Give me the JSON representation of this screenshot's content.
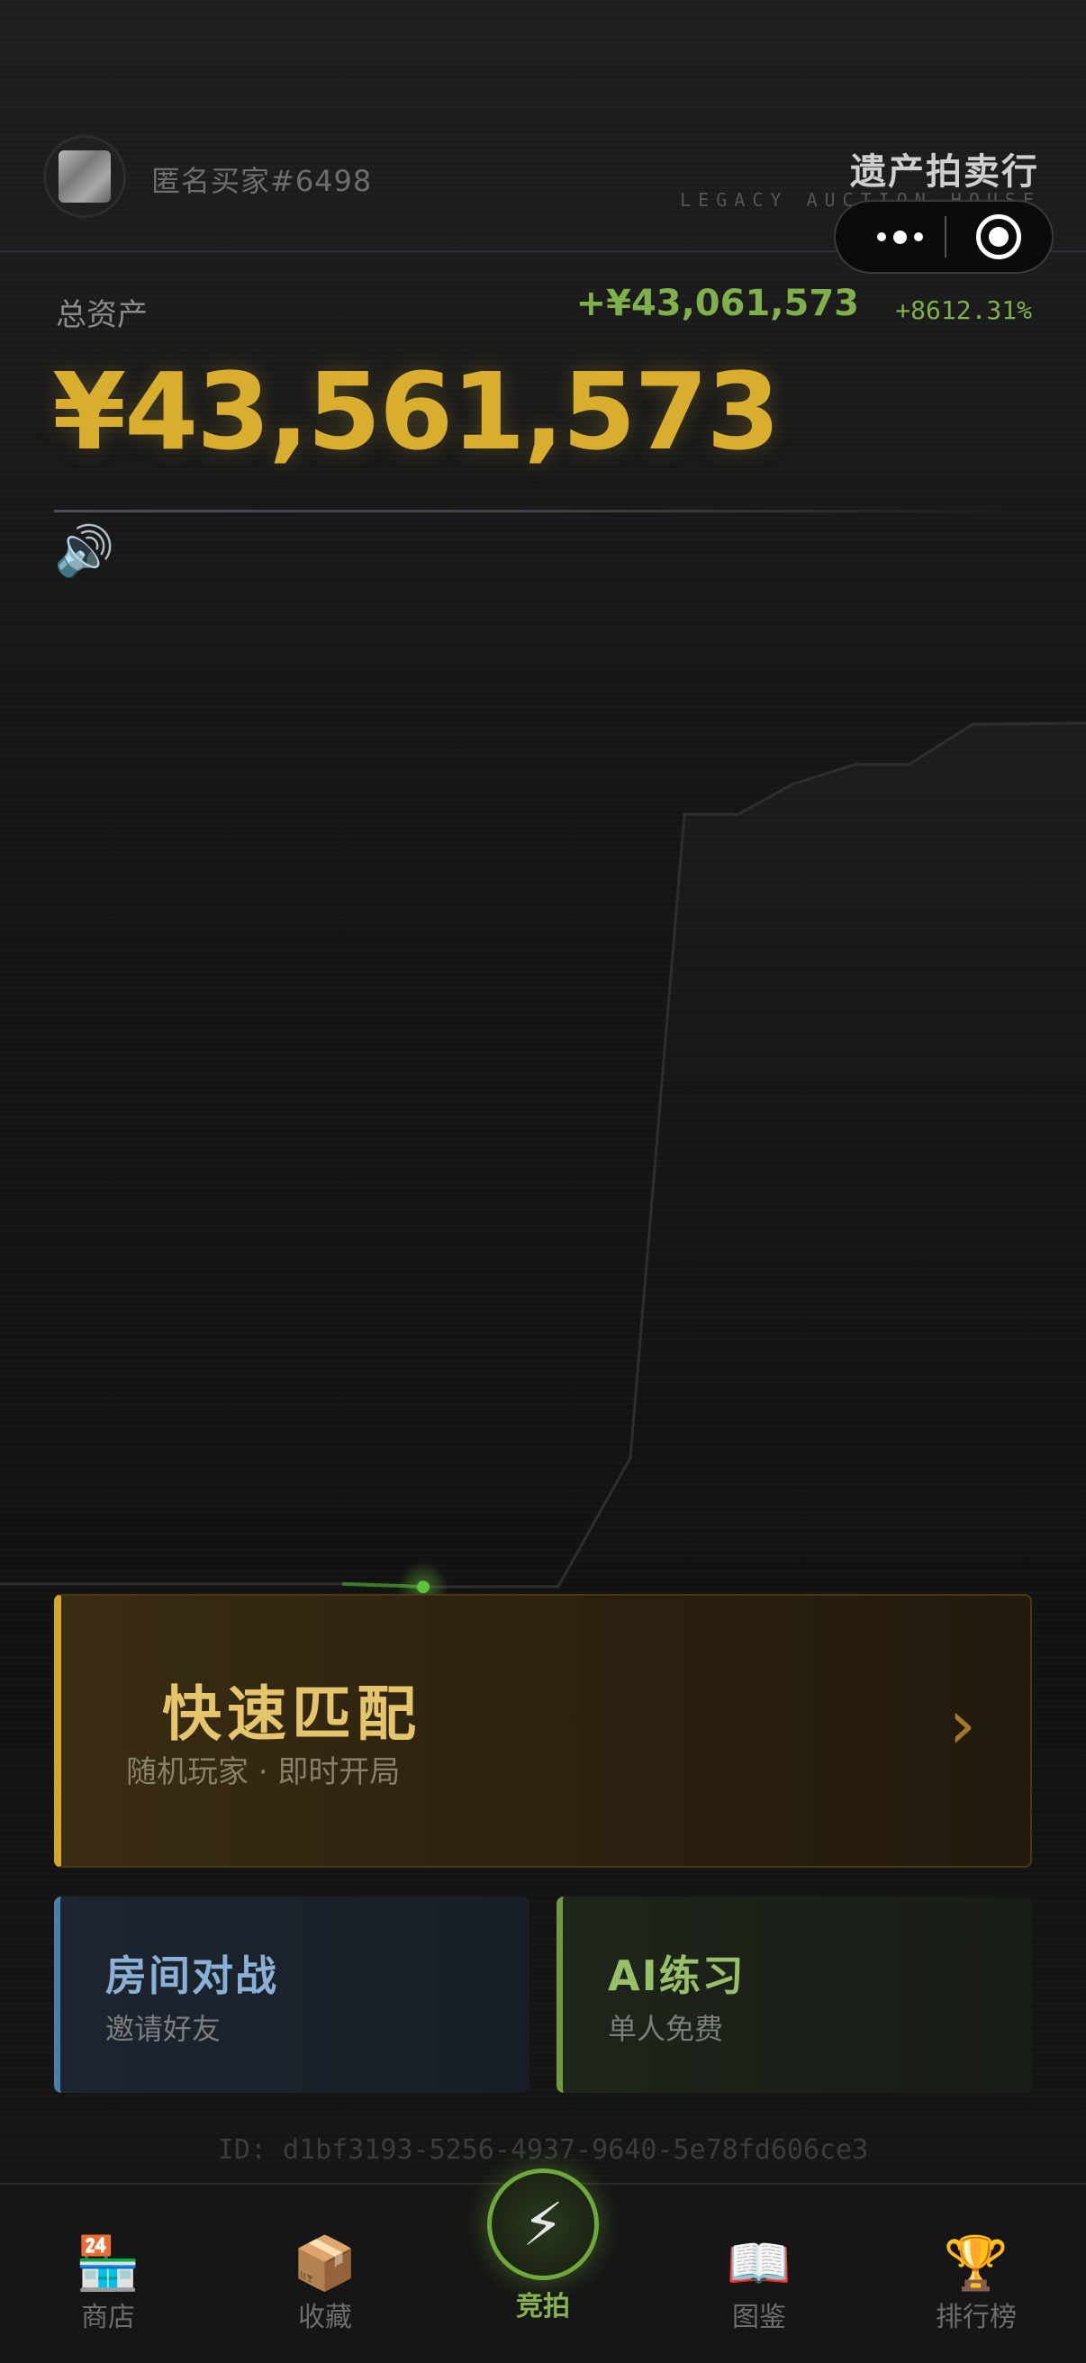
{
  "header": {
    "username": "匿名买家#6498",
    "brand_title": "遗产拍卖行",
    "brand_subtitle": "LEGACY AUCTION HOUSE"
  },
  "assets": {
    "label": "总资产",
    "total": "¥43,561,573",
    "gain_amount": "+¥43,061,573",
    "gain_percent": "+8612.31%"
  },
  "chart_data": {
    "type": "line",
    "title": "",
    "xlabel": "",
    "ylabel": "",
    "grid": false,
    "y": [
      500000,
      500000,
      500000,
      500000,
      500000,
      400000,
      350000,
      380000,
      6800000,
      39000000,
      39000000,
      40500000,
      41500000,
      41500000,
      43500000,
      43561573
    ],
    "ylim": [
      0,
      50000000
    ]
  },
  "quick_match": {
    "title": "快速匹配",
    "subtitle": "随机玩家 · 即时开局",
    "arrow": "›"
  },
  "room_battle": {
    "title": "房间对战",
    "subtitle": "邀请好友"
  },
  "ai_practice": {
    "title": "AI练习",
    "subtitle": "单人免费"
  },
  "user_id": "ID: d1bf3193-5256-4937-9640-5e78fd606ce3",
  "tabs": [
    {
      "label": "商店",
      "icon": "🏪"
    },
    {
      "label": "收藏",
      "icon": "📦"
    },
    {
      "label": "竞拍",
      "icon": "⚡"
    },
    {
      "label": "图鉴",
      "icon": "📖"
    },
    {
      "label": "排行榜",
      "icon": "🏆"
    }
  ],
  "colors": {
    "gold": "#d9ae2e",
    "green": "#7fb04a",
    "blue": "#8ab0d6"
  }
}
